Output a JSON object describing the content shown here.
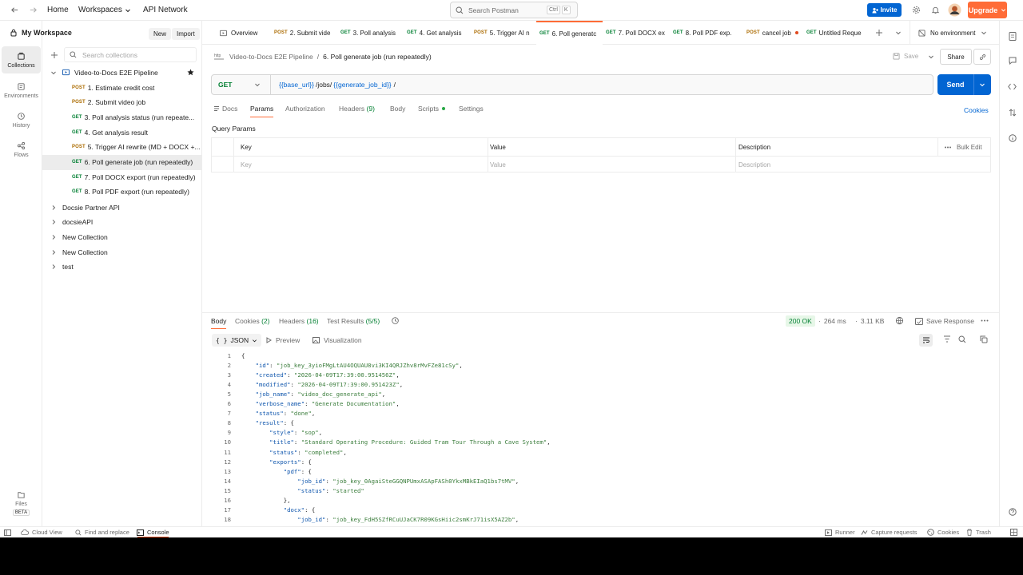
{
  "topbar": {
    "home": "Home",
    "workspaces": "Workspaces",
    "api_network": "API Network",
    "search_placeholder": "Search Postman",
    "shortcut_ctrl": "Ctrl",
    "shortcut_k": "K",
    "invite": "Invite",
    "upgrade": "Upgrade"
  },
  "rail": {
    "collections": "Collections",
    "environments": "Environments",
    "history": "History",
    "flows": "Flows",
    "files": "Files",
    "beta": "BETA"
  },
  "sidebar": {
    "workspace": "My Workspace",
    "new": "New",
    "import": "Import",
    "search_placeholder": "Search collections",
    "collection": "Video-to-Docs E2E Pipeline",
    "requests": [
      {
        "method": "POST",
        "name": "1. Estimate credit cost"
      },
      {
        "method": "POST",
        "name": "2. Submit video job"
      },
      {
        "method": "GET",
        "name": "3. Poll analysis status (run repeate..."
      },
      {
        "method": "GET",
        "name": "4. Get analysis result"
      },
      {
        "method": "POST",
        "name": "5. Trigger AI rewrite (MD + DOCX +..."
      },
      {
        "method": "GET",
        "name": "6. Poll generate job (run repeatedly)"
      },
      {
        "method": "GET",
        "name": "7. Poll DOCX export (run repeatedly)"
      },
      {
        "method": "GET",
        "name": "8. Poll PDF export (run repeatedly)"
      }
    ],
    "other_collections": [
      "Docsie Partner API",
      "docsieAPI",
      "New Collection",
      "New Collection",
      "test"
    ]
  },
  "tabs": [
    {
      "method": "",
      "label": "Overview"
    },
    {
      "method": "POST",
      "label": "2. Submit vide"
    },
    {
      "method": "GET",
      "label": "3. Poll analysis"
    },
    {
      "method": "GET",
      "label": "4. Get analysis"
    },
    {
      "method": "POST",
      "label": "5. Trigger AI n"
    },
    {
      "method": "GET",
      "label": "6. Poll generatc"
    },
    {
      "method": "GET",
      "label": "7. Poll DOCX ex"
    },
    {
      "method": "GET",
      "label": "8. Poll PDF exp."
    },
    {
      "method": "POST",
      "label": "cancel job"
    },
    {
      "method": "GET",
      "label": "Untitled Reque"
    }
  ],
  "environment": "No environment",
  "request": {
    "breadcrumb_parent": "Video-to-Docs E2E Pipeline",
    "separator": "/",
    "breadcrumb_current": "6. Poll generate job (run repeatedly)",
    "save": "Save",
    "share": "Share",
    "method": "GET",
    "url_var1": "{{base_url}}",
    "url_mid": "/jobs/",
    "url_var2": "{{generate_job_id}}",
    "url_end": "/",
    "send": "Send",
    "tabs": {
      "docs": "Docs",
      "params": "Params",
      "authorization": "Authorization",
      "headers": "Headers",
      "headers_count": "(9)",
      "body": "Body",
      "scripts": "Scripts",
      "settings": "Settings"
    },
    "cookies": "Cookies",
    "query_params": "Query Params",
    "table": {
      "key": "Key",
      "value": "Value",
      "description": "Description",
      "bulk_edit": "Bulk Edit",
      "key_ph": "Key",
      "value_ph": "Value",
      "desc_ph": "Description"
    }
  },
  "response": {
    "tabs": {
      "body": "Body",
      "cookies": "Cookies",
      "cookies_count": "(2)",
      "headers": "Headers",
      "headers_count": "(16)",
      "tests": "Test Results",
      "tests_count": "(5/5)"
    },
    "status": "200 OK",
    "time": "264 ms",
    "size": "3.11 KB",
    "save_response": "Save Response",
    "format": "JSON",
    "preview": "Preview",
    "visualization": "Visualization",
    "lines": [
      {
        "n": "1",
        "t": "{"
      },
      {
        "n": "2",
        "t": "    \"id\": \"job_key_3yioFMgLtAU4OQUAU8vi3KI4QRJZhv8rMvFZe81cSy\","
      },
      {
        "n": "3",
        "t": "    \"created\": \"2026-04-09T17:39:00.951456Z\","
      },
      {
        "n": "4",
        "t": "    \"modified\": \"2026-04-09T17:39:00.951423Z\","
      },
      {
        "n": "5",
        "t": "    \"job_name\": \"video_doc_generate_api\","
      },
      {
        "n": "6",
        "t": "    \"verbose_name\": \"Generate Documentation\","
      },
      {
        "n": "7",
        "t": "    \"status\": \"done\","
      },
      {
        "n": "8",
        "t": "    \"result\": {"
      },
      {
        "n": "9",
        "t": "        \"style\": \"sop\","
      },
      {
        "n": "10",
        "t": "        \"title\": \"Standard Operating Procedure: Guided Tram Tour Through a Cave System\","
      },
      {
        "n": "11",
        "t": "        \"status\": \"completed\","
      },
      {
        "n": "12",
        "t": "        \"exports\": {"
      },
      {
        "n": "13",
        "t": "            \"pdf\": {"
      },
      {
        "n": "14",
        "t": "                \"job_id\": \"job_key_0AgaiSteGGQNPUmxASApFASh0YkxMBkEIaQ1bs7tMV\","
      },
      {
        "n": "15",
        "t": "                \"status\": \"started\""
      },
      {
        "n": "16",
        "t": "            },"
      },
      {
        "n": "17",
        "t": "            \"docx\": {"
      },
      {
        "n": "18",
        "t": "                \"job_id\": \"job_key_FdH5SZfRCuUJaCK7R09KGsHiic2smKrJ71isX5AZ2b\","
      }
    ]
  },
  "statusbar": {
    "cloud_view": "Cloud View",
    "find_replace": "Find and replace",
    "console": "Console",
    "runner": "Runner",
    "capture": "Capture requests",
    "cookies": "Cookies",
    "trash": "Trash"
  },
  "colors": {
    "accent": "#ff6c37",
    "primary": "#0265d2",
    "get": "#007f31",
    "post": "#ab6b00",
    "ok_bg": "#e7f7e8"
  }
}
